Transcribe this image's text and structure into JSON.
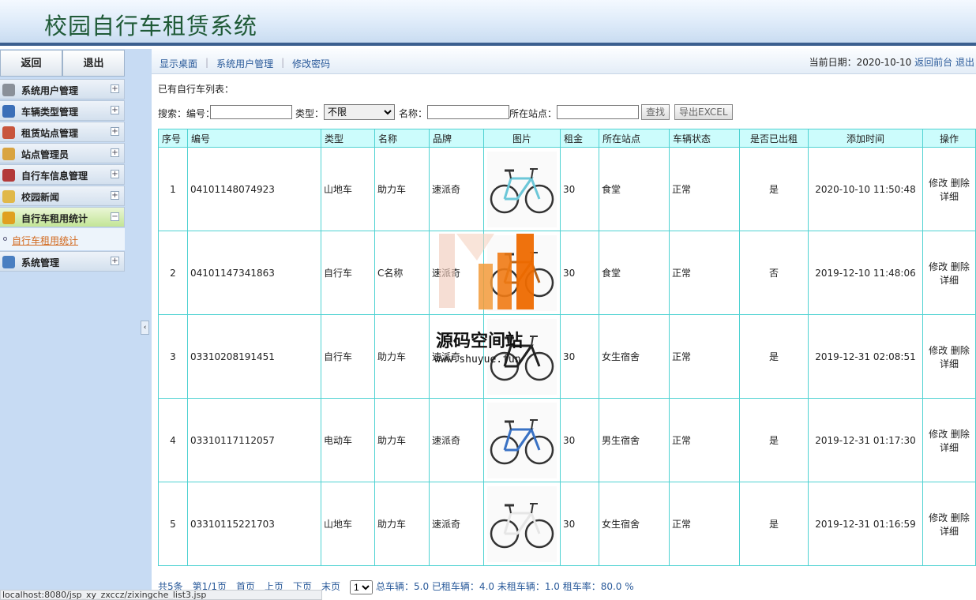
{
  "app": {
    "title": "校园自行车租赁系统"
  },
  "sidebar": {
    "back_label": "返回",
    "logout_label": "退出",
    "items": [
      {
        "label": "系统用户管理",
        "icon": "gear-icon",
        "toggle": "+",
        "color": "#8a9099"
      },
      {
        "label": "车辆类型管理",
        "icon": "monitor-icon",
        "toggle": "+",
        "color": "#3b6fb8"
      },
      {
        "label": "租赁站点管理",
        "icon": "table-icon",
        "toggle": "+",
        "color": "#c8553d"
      },
      {
        "label": "站点管理员",
        "icon": "user-icon",
        "toggle": "+",
        "color": "#d9a441"
      },
      {
        "label": "自行车信息管理",
        "icon": "calendar-icon",
        "toggle": "+",
        "color": "#b33a3a"
      },
      {
        "label": "校园新闻",
        "icon": "folder-icon",
        "toggle": "+",
        "color": "#e0b84a"
      },
      {
        "label": "自行车租用统计",
        "icon": "coins-icon",
        "toggle": "−",
        "color": "#e0a020"
      },
      {
        "label": "系统管理",
        "icon": "bar-chart-icon",
        "toggle": "+",
        "color": "#4a7fc1"
      }
    ],
    "submenu_label": "自行车租用统计"
  },
  "navbar": {
    "links": [
      "显示桌面",
      "系统用户管理",
      "修改密码"
    ],
    "date_label": "当前日期：2020-10-10",
    "back_front": "返回前台",
    "logout": "退出"
  },
  "list_caption": "已有自行车列表：",
  "search": {
    "number_label": "搜索：编号：",
    "type_label": "类型：",
    "type_selected": "不限",
    "name_label": "名称：",
    "station_label": "所在站点：",
    "find_button": "查找",
    "export_button": "导出EXCEL"
  },
  "table": {
    "headers": [
      "序号",
      "编号",
      "类型",
      "名称",
      "品牌",
      "图片",
      "租金",
      "所在站点",
      "车辆状态",
      "是否已出租",
      "添加时间",
      "操作"
    ],
    "rows": [
      {
        "idx": "1",
        "no": "04101148074923",
        "type": "山地车",
        "name": "助力车",
        "brand": "速派奇",
        "rent": "30",
        "station": "食堂",
        "status": "正常",
        "rented": "是",
        "time": "2020-10-10 11:50:48"
      },
      {
        "idx": "2",
        "no": "04101147341863",
        "type": "自行车",
        "name": "C名称",
        "brand": "速派奇",
        "rent": "30",
        "station": "食堂",
        "status": "正常",
        "rented": "否",
        "time": "2019-12-10 11:48:06"
      },
      {
        "idx": "3",
        "no": "03310208191451",
        "type": "自行车",
        "name": "助力车",
        "brand": "速派奇",
        "rent": "30",
        "station": "女生宿舍",
        "status": "正常",
        "rented": "是",
        "time": "2019-12-31 02:08:51"
      },
      {
        "idx": "4",
        "no": "03310117112057",
        "type": "电动车",
        "name": "助力车",
        "brand": "速派奇",
        "rent": "30",
        "station": "男生宿舍",
        "status": "正常",
        "rented": "是",
        "time": "2019-12-31 01:17:30"
      },
      {
        "idx": "5",
        "no": "03310115221703",
        "type": "山地车",
        "name": "助力车",
        "brand": "速派奇",
        "rent": "30",
        "station": "女生宿舍",
        "status": "正常",
        "rented": "是",
        "time": "2019-12-31 01:16:59"
      }
    ],
    "op_edit": "修改",
    "op_delete": "删除",
    "op_detail": "详细"
  },
  "footer": {
    "total": "共5条",
    "page_info": "第1/1页",
    "first": "首页",
    "prev": "上页",
    "next": "下页",
    "last": "末页",
    "page_select": "1",
    "stats": "总车辆：5.0 已租车辆：4.0 未租车辆：1.0 租车率：80.0 %"
  },
  "statusbar": {
    "url": "localhost:8080/jsp_xy_zxccz/zixingche_list3.jsp"
  },
  "watermark": {
    "text": "源码空间站",
    "url": "www.shuyue.fun"
  }
}
